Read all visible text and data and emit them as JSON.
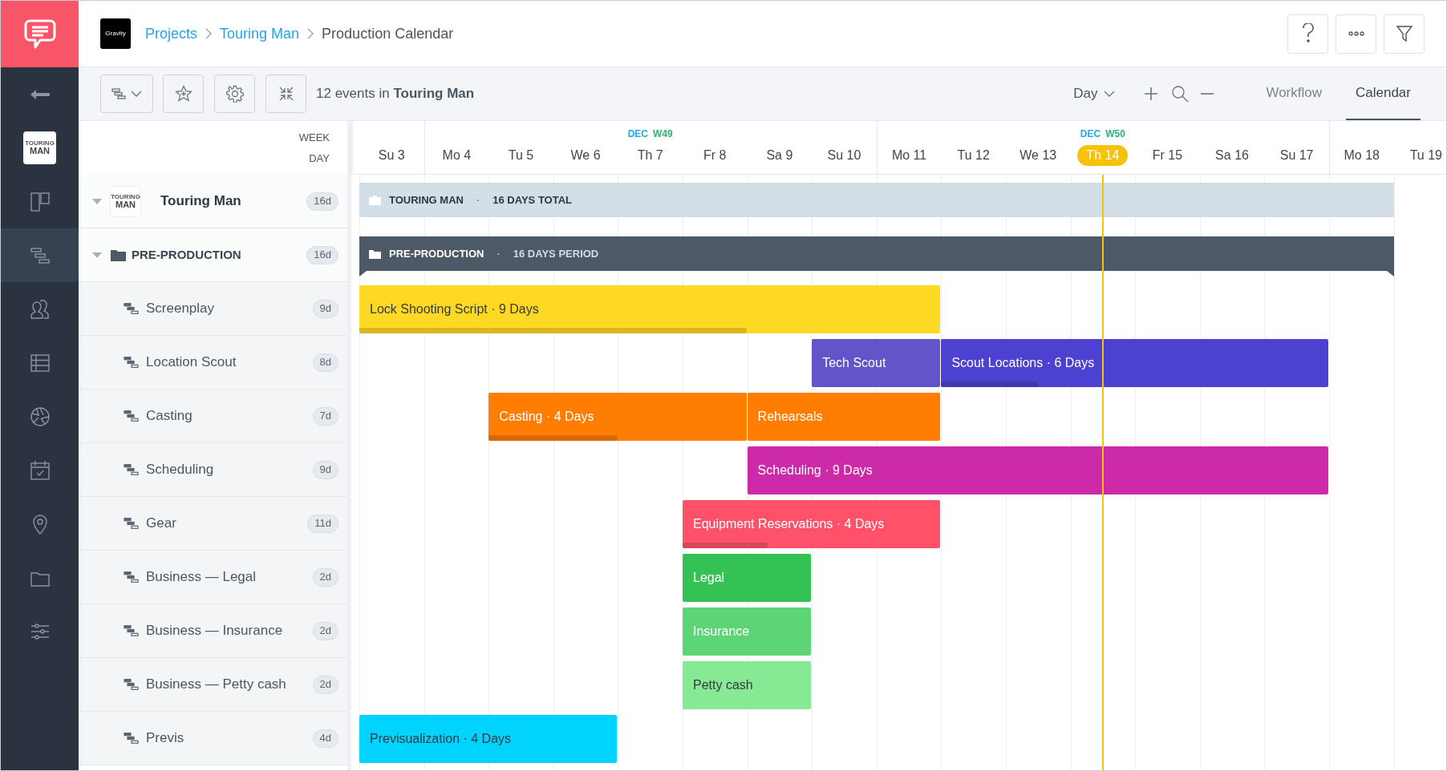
{
  "breadcrumb": {
    "workspace_logo": "Gravity",
    "items": [
      {
        "label": "Projects",
        "link": true
      },
      {
        "label": "Touring Man",
        "link": true
      },
      {
        "label": "Production Calendar",
        "link": false
      }
    ]
  },
  "sidebar": {
    "project_logo": [
      "TOURING",
      "MAN"
    ],
    "items": [
      {
        "kind": "board",
        "selected": false
      },
      {
        "kind": "gantt",
        "selected": true
      },
      {
        "kind": "people",
        "selected": false
      },
      {
        "kind": "table",
        "selected": false
      },
      {
        "kind": "aperture",
        "selected": false
      },
      {
        "kind": "calendar",
        "selected": false
      },
      {
        "kind": "location",
        "selected": false
      },
      {
        "kind": "folder",
        "selected": false
      },
      {
        "kind": "sliders",
        "selected": false
      }
    ]
  },
  "toolbar": {
    "summary": "12 events in **Touring Man**",
    "view": "Day",
    "tabs": [
      {
        "label": "Workflow",
        "selected": false
      },
      {
        "label": "Calendar",
        "selected": true
      }
    ]
  },
  "timeline": {
    "header_labels": [
      "WEEK",
      "DAY"
    ],
    "days": [
      {
        "label": "Su 3",
        "week_start": false,
        "today": false
      },
      {
        "label": "Mo 4",
        "week_start": true,
        "today": false
      },
      {
        "label": "Tu 5",
        "week_start": false,
        "today": false
      },
      {
        "label": "We 6",
        "week_start": false,
        "today": false
      },
      {
        "label": "Th 7",
        "week_start": false,
        "today": false,
        "month": "DEC",
        "week": "W49"
      },
      {
        "label": "Fr 8",
        "week_start": false,
        "today": false
      },
      {
        "label": "Sa 9",
        "week_start": false,
        "today": false
      },
      {
        "label": "Su 10",
        "week_start": false,
        "today": false
      },
      {
        "label": "Mo 11",
        "week_start": true,
        "today": false
      },
      {
        "label": "Tu 12",
        "week_start": false,
        "today": false
      },
      {
        "label": "We 13",
        "week_start": false,
        "today": false
      },
      {
        "label": "Th 14",
        "week_start": false,
        "today": true,
        "month": "DEC",
        "week": "W50"
      },
      {
        "label": "Fr 15",
        "week_start": false,
        "today": false
      },
      {
        "label": "Sa 16",
        "week_start": false,
        "today": false
      },
      {
        "label": "Su 17",
        "week_start": false,
        "today": false
      },
      {
        "label": "Mo 18",
        "week_start": true,
        "today": false
      },
      {
        "label": "Tu 19",
        "week_start": false,
        "today": false
      }
    ]
  },
  "rows": [
    {
      "kind": "project",
      "label": "Touring Man",
      "logo": [
        "TOURING",
        "MAN"
      ],
      "expanded": true,
      "duration": "16d",
      "bars": [
        {
          "kind": "summary",
          "label": "TOURING MAN",
          "separator": "·",
          "detail": "16 DAYS TOTAL"
        }
      ]
    },
    {
      "kind": "group",
      "label": "PRE-PRODUCTION",
      "expanded": true,
      "duration": "16d",
      "bars": [
        {
          "kind": "group",
          "label": "PRE-PRODUCTION",
          "separator": "·",
          "detail": "16 DAYS PERIOD"
        }
      ]
    },
    {
      "kind": "task",
      "label": "Screenplay",
      "duration": "9d",
      "bars": [
        {
          "kind": "event",
          "label": "Lock Shooting Script · 9 Days",
          "color": "#fdd923",
          "dark_text": true,
          "level": 0.667
        }
      ]
    },
    {
      "kind": "task",
      "label": "Location Scout",
      "duration": "8d",
      "bars": [
        {
          "kind": "event",
          "label": "Tech Scout",
          "color": "#6155c9",
          "dark_text": false
        },
        {
          "kind": "event",
          "label": "Scout Locations · 6 Days",
          "color": "#4c41d1",
          "dark_text": false,
          "level": 0.25
        }
      ]
    },
    {
      "kind": "task",
      "label": "Casting",
      "duration": "7d",
      "bars": [
        {
          "kind": "event",
          "label": "Casting · 4 Days",
          "color": "#ff7d00",
          "dark_text": false,
          "level": 0.5
        },
        {
          "kind": "event",
          "label": "Rehearsals",
          "color": "#ff7d00",
          "dark_text": false
        }
      ]
    },
    {
      "kind": "task",
      "label": "Scheduling",
      "duration": "9d",
      "bars": [
        {
          "kind": "event",
          "label": "Scheduling · 9 Days",
          "color": "#cc2aa8",
          "dark_text": false
        }
      ]
    },
    {
      "kind": "task",
      "label": "Gear",
      "duration": "11d",
      "bars": [
        {
          "kind": "event",
          "label": "Equipment Reservations · 4 Days",
          "color": "#ff526a",
          "dark_text": false,
          "level": 0.33
        }
      ]
    },
    {
      "kind": "task",
      "label": "Business — Legal",
      "duration": "2d",
      "bars": [
        {
          "kind": "event",
          "label": "Legal",
          "color": "#34c254",
          "dark_text": false
        }
      ]
    },
    {
      "kind": "task",
      "label": "Business — Insurance",
      "duration": "2d",
      "bars": [
        {
          "kind": "event",
          "label": "Insurance",
          "color": "#5dd577",
          "dark_text": false
        }
      ]
    },
    {
      "kind": "task",
      "label": "Business — Petty cash",
      "duration": "2d",
      "bars": [
        {
          "kind": "event",
          "label": "Petty cash",
          "color": "#88e994",
          "dark_text": true
        }
      ]
    },
    {
      "kind": "task",
      "label": "Previs",
      "duration": "4d",
      "bars": [
        {
          "kind": "event",
          "label": "Previsualization · 4 Days",
          "color": "#00d4fe",
          "dark_text": true
        }
      ]
    }
  ]
}
